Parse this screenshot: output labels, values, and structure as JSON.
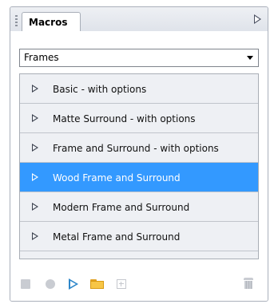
{
  "panel": {
    "tab_title": "Macros"
  },
  "set_select": {
    "value": "Frames"
  },
  "macros": [
    {
      "label": "Basic - with options",
      "selected": false
    },
    {
      "label": "Matte Surround - with options",
      "selected": false
    },
    {
      "label": "Frame and Surround - with options",
      "selected": false
    },
    {
      "label": "Wood Frame and Surround",
      "selected": true
    },
    {
      "label": "Modern Frame and Surround",
      "selected": false
    },
    {
      "label": "Metal Frame and Surround",
      "selected": false
    }
  ],
  "toolbar": {
    "icons": [
      "stop-icon",
      "record-icon",
      "play-icon",
      "folder-icon",
      "new-macro-icon",
      "trash-icon"
    ]
  },
  "colors": {
    "selection": "#3399ff",
    "play_accent": "#2d86c9",
    "folder": "#f7c646"
  }
}
